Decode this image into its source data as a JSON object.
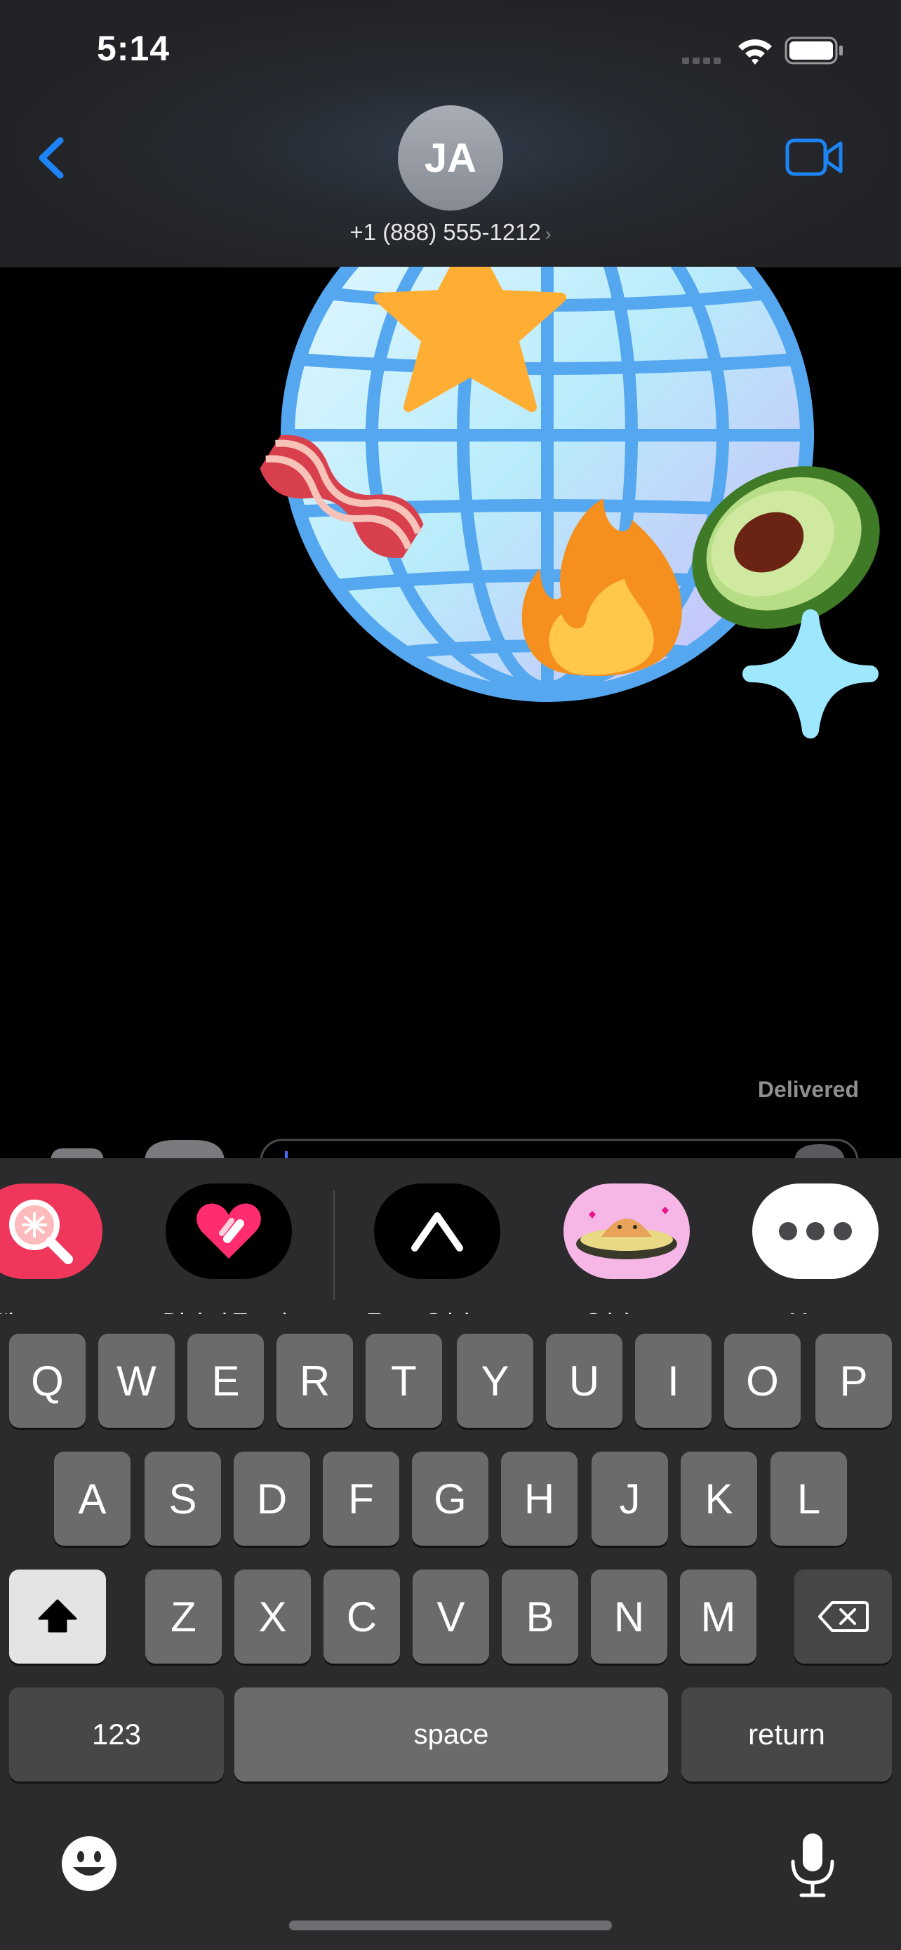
{
  "status_bar": {
    "time": "5:14"
  },
  "header": {
    "avatar_initials": "JA",
    "contact_phone": "+1 (888) 555-1212",
    "chevron": "›"
  },
  "conversation": {
    "stickers": [
      "globe-sticker",
      "star-sticker",
      "bacon-sticker",
      "fire-sticker",
      "avocado-sticker",
      "sparkle-sticker"
    ],
    "delivered_label": "Delivered"
  },
  "app_strip": {
    "items": [
      {
        "label": "#images",
        "icon": "images-search-icon",
        "bg": "#f0365b"
      },
      {
        "label": "Digital Touch",
        "icon": "digital-touch-heart-icon",
        "bg": "#000000"
      },
      {
        "label": "Expo Stickers",
        "icon": "expo-logo-icon",
        "bg": "#000000"
      },
      {
        "label": "Stickers",
        "icon": "avocado-sticker-icon",
        "bg": "#f7b7e6"
      },
      {
        "label": "More",
        "icon": "more-dots-icon",
        "bg": "#ffffff"
      }
    ]
  },
  "keyboard": {
    "row1": [
      "Q",
      "W",
      "E",
      "R",
      "T",
      "Y",
      "U",
      "I",
      "O",
      "P"
    ],
    "row2": [
      "A",
      "S",
      "D",
      "F",
      "G",
      "H",
      "J",
      "K",
      "L"
    ],
    "row3": [
      "Z",
      "X",
      "C",
      "V",
      "B",
      "N",
      "M"
    ],
    "numbers_label": "123",
    "space_label": "space",
    "return_label": "return"
  },
  "colors": {
    "accent": "#1d84f5",
    "key": "#6b6b6d",
    "key_function": "#474749",
    "keyboard_bg": "#2b2b2d"
  }
}
